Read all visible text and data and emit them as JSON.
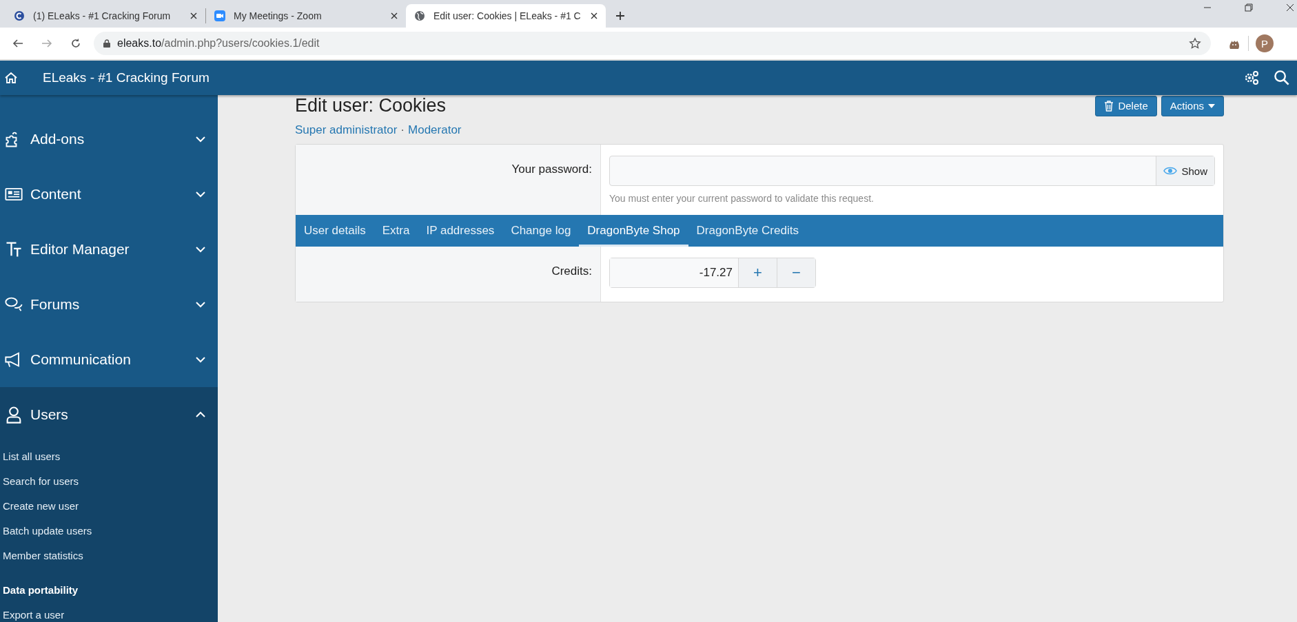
{
  "browser_tabs": [
    {
      "title": "(1) ELeaks - #1 Cracking Forum",
      "kind": "site",
      "selected": false
    },
    {
      "title": "My Meetings - Zoom",
      "kind": "video",
      "selected": false
    },
    {
      "title": "Edit user: Cookies | ELeaks - #1 C",
      "kind": "globe",
      "selected": true
    }
  ],
  "address_bar": {
    "domain": "eleaks.to",
    "path": "/admin.php?users/cookies.1/edit"
  },
  "profile": {
    "initial": "P"
  },
  "navbar": {
    "title": "ELeaks - #1 Cracking Forum"
  },
  "sidebar": {
    "sections": [
      {
        "label": "Add-ons",
        "kind": "puzzle",
        "expanded": false
      },
      {
        "label": "Content",
        "kind": "news",
        "expanded": false
      },
      {
        "label": "Editor Manager",
        "kind": "text",
        "expanded": false
      },
      {
        "label": "Forums",
        "kind": "chat",
        "expanded": false
      },
      {
        "label": "Communication",
        "kind": "megaphone",
        "expanded": false
      },
      {
        "label": "Users",
        "kind": "user",
        "expanded": true,
        "children": [
          {
            "label": "List all users",
            "kind": "link"
          },
          {
            "label": "Search for users",
            "kind": "link"
          },
          {
            "label": "Create new user",
            "kind": "link"
          },
          {
            "label": "Batch update users",
            "kind": "link"
          },
          {
            "label": "Member statistics",
            "kind": "link"
          },
          {
            "label": "Data portability",
            "kind": "heading"
          },
          {
            "label": "Export a user",
            "kind": "link"
          }
        ]
      }
    ]
  },
  "page": {
    "title": "Edit user: Cookies",
    "roles": [
      "Super administrator",
      "Moderator"
    ],
    "separator": "·",
    "buttons": [
      {
        "label": "Delete",
        "kind": "delete"
      },
      {
        "label": "Actions",
        "kind": "menu"
      }
    ]
  },
  "form": {
    "password": {
      "label": "Your password:",
      "toggle": "Show",
      "hint": "You must enter your current password to validate this request."
    },
    "tabs": [
      {
        "label": "User details",
        "selected": false
      },
      {
        "label": "Extra",
        "selected": false
      },
      {
        "label": "IP addresses",
        "selected": false
      },
      {
        "label": "Change log",
        "selected": false
      },
      {
        "label": "DragonByte Shop",
        "selected": true
      },
      {
        "label": "DragonByte Credits",
        "selected": false
      }
    ],
    "credits": {
      "label": "Credits:",
      "value": "-17.27",
      "plus": "+",
      "minus": "−"
    }
  }
}
